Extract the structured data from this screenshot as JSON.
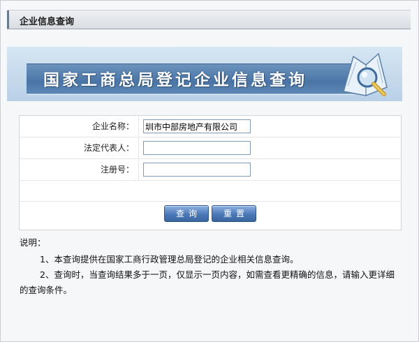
{
  "panel": {
    "title": "企业信息查询"
  },
  "banner": {
    "text": "国家工商总局登记企业信息查询"
  },
  "form": {
    "fields": [
      {
        "label": "企业名称：",
        "value": "圳市中部房地产有限公司"
      },
      {
        "label": "法定代表人：",
        "value": ""
      },
      {
        "label": "注册号：",
        "value": ""
      }
    ],
    "buttons": {
      "query": "查询",
      "reset": "重置"
    }
  },
  "notes": {
    "heading": "说明：",
    "items": [
      "1、本查询提供在国家工商行政管理总局登记的企业相关信息查询。",
      "2、查询时，当查询结果多于一页，仅显示一页内容，如需查看更精确的信息，请输入更详细的查询条件。"
    ]
  },
  "colors": {
    "banner_stripe": "#4a75a6",
    "button": "#4b78b7",
    "title_bar": "#d9dde3"
  }
}
